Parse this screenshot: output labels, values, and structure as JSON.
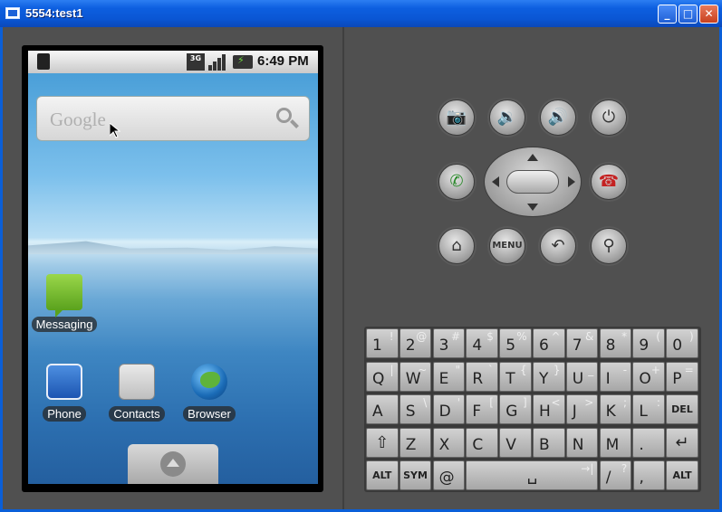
{
  "window": {
    "title": "5554:test1",
    "controls": [
      "minimize",
      "maximize",
      "close"
    ]
  },
  "statusbar": {
    "network": "3G",
    "time": "6:49 PM"
  },
  "search_widget": {
    "logo": "Google",
    "placeholder": ""
  },
  "home_apps": {
    "messaging": "Messaging",
    "phone": "Phone",
    "contacts": "Contacts",
    "browser": "Browser"
  },
  "hardware_buttons": {
    "menu": "MENU",
    "icons": [
      "camera-icon",
      "volume-down-icon",
      "volume-up-icon",
      "power-icon",
      "call-icon",
      "end-call-icon",
      "home-icon",
      "back-icon",
      "search-icon"
    ]
  },
  "keyboard": {
    "row1": [
      {
        "main": "1",
        "alt": "!"
      },
      {
        "main": "2",
        "alt": "@"
      },
      {
        "main": "3",
        "alt": "#"
      },
      {
        "main": "4",
        "alt": "$"
      },
      {
        "main": "5",
        "alt": "%"
      },
      {
        "main": "6",
        "alt": "^"
      },
      {
        "main": "7",
        "alt": "&"
      },
      {
        "main": "8",
        "alt": "*"
      },
      {
        "main": "9",
        "alt": "("
      },
      {
        "main": "0",
        "alt": ")"
      }
    ],
    "row2": [
      {
        "main": "Q",
        "alt": "|"
      },
      {
        "main": "W",
        "alt": "~"
      },
      {
        "main": "E",
        "alt": "\""
      },
      {
        "main": "R",
        "alt": "`"
      },
      {
        "main": "T",
        "alt": "{"
      },
      {
        "main": "Y",
        "alt": "}"
      },
      {
        "main": "U",
        "alt": "_"
      },
      {
        "main": "I",
        "alt": "-"
      },
      {
        "main": "O",
        "alt": "+"
      },
      {
        "main": "P",
        "alt": "="
      }
    ],
    "row3": [
      {
        "main": "A",
        "alt": ""
      },
      {
        "main": "S",
        "alt": "\\"
      },
      {
        "main": "D",
        "alt": "'"
      },
      {
        "main": "F",
        "alt": "["
      },
      {
        "main": "G",
        "alt": "]"
      },
      {
        "main": "H",
        "alt": "<"
      },
      {
        "main": "J",
        "alt": ">"
      },
      {
        "main": "K",
        "alt": ";"
      },
      {
        "main": "L",
        "alt": ":"
      },
      {
        "main": "DEL",
        "alt": ""
      }
    ],
    "row4": [
      {
        "main": "⇧",
        "alt": ""
      },
      {
        "main": "Z",
        "alt": ""
      },
      {
        "main": "X",
        "alt": ""
      },
      {
        "main": "C",
        "alt": ""
      },
      {
        "main": "V",
        "alt": ""
      },
      {
        "main": "B",
        "alt": ""
      },
      {
        "main": "N",
        "alt": ""
      },
      {
        "main": "M",
        "alt": ""
      },
      {
        "main": ".",
        "alt": ""
      },
      {
        "main": "↵",
        "alt": ""
      }
    ],
    "row5": [
      {
        "main": "ALT",
        "alt": ""
      },
      {
        "main": "SYM",
        "alt": ""
      },
      {
        "main": "@",
        "alt": ""
      },
      {
        "main": "␣",
        "alt": "→|"
      },
      {
        "main": "/",
        "alt": "?"
      },
      {
        "main": ",",
        "alt": ""
      },
      {
        "main": "ALT",
        "alt": ""
      }
    ]
  }
}
